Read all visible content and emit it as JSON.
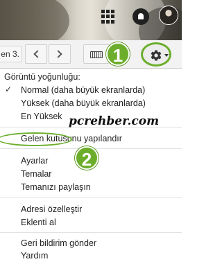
{
  "header": {
    "apps_icon": "apps-grid-icon",
    "notifications_icon": "notifications-icon",
    "avatar_icon": "account-avatar-icon"
  },
  "toolbar": {
    "page_count_text": "en 3.",
    "prev_icon": "chevron-left-icon",
    "next_icon": "chevron-right-icon",
    "keyboard_icon": "keyboard-icon",
    "settings_icon": "gear-icon",
    "marker_1": "1"
  },
  "menu": {
    "density_heading": "Görüntü yoğunluğu:",
    "density_options": [
      {
        "label": "Normal (daha büyük ekranlarda)",
        "checked": true
      },
      {
        "label": "Yüksek (daha büyük ekranlarda)",
        "checked": false
      },
      {
        "label": "En Yüksek",
        "checked": false
      }
    ],
    "configure_inbox": "Gelen kutusunu yapılandır",
    "settings": "Ayarlar",
    "themes": "Temalar",
    "share_themes": "Temanızı paylaşın",
    "customize_address": "Adresi özelleştir",
    "get_addons": "Eklenti al",
    "send_feedback": "Geri bildirim gönder",
    "help": "Yardım",
    "marker_2": "2",
    "watermark": "pcrehber.com"
  },
  "colors": {
    "highlight_green": "#6cae2c"
  }
}
